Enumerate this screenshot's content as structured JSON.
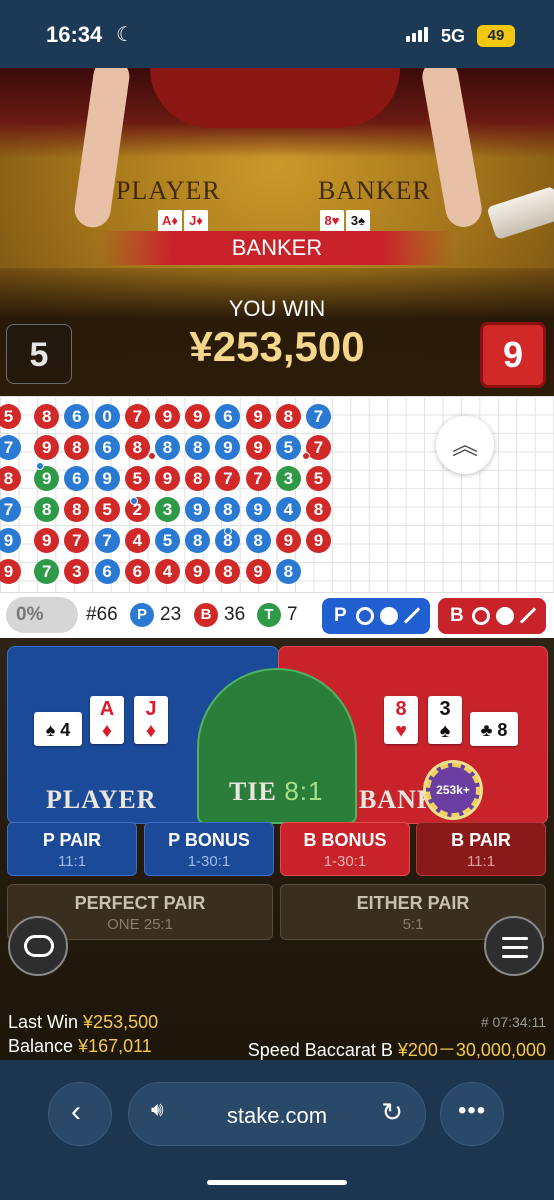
{
  "status_bar": {
    "time": "16:34",
    "network": "5G",
    "battery": "49"
  },
  "video": {
    "felt_player": "PLAYER",
    "felt_banker": "BANKER",
    "player_cards_mini": [
      {
        "rank": "A",
        "suit": "♦"
      },
      {
        "rank": "J",
        "suit": "♦"
      }
    ],
    "banker_cards_mini": [
      {
        "rank": "8",
        "suit": "♥"
      },
      {
        "rank": "3",
        "suit": "♠"
      }
    ],
    "result_banner": "BANKER",
    "win_title": "YOU WIN",
    "win_amount": "¥253,500",
    "player_score": "5",
    "banker_score": "9"
  },
  "roadmap": {
    "columns": [
      [
        {
          "v": "5",
          "c": "r"
        },
        {
          "v": "7",
          "c": "b"
        },
        {
          "v": "8",
          "c": "r"
        },
        {
          "v": "7",
          "c": "b"
        },
        {
          "v": "9",
          "c": "b"
        },
        {
          "v": "9",
          "c": "r"
        }
      ],
      [
        {
          "v": "8",
          "c": "r"
        },
        {
          "v": "9",
          "c": "r"
        },
        {
          "v": "9",
          "c": "g"
        },
        {
          "v": "8",
          "c": "g"
        },
        {
          "v": "9",
          "c": "r"
        },
        {
          "v": "7",
          "c": "g"
        }
      ],
      [
        {
          "v": "6",
          "c": "b"
        },
        {
          "v": "8",
          "c": "r"
        },
        {
          "v": "6",
          "c": "b"
        },
        {
          "v": "8",
          "c": "r"
        },
        {
          "v": "7",
          "c": "r"
        },
        {
          "v": "3",
          "c": "r"
        }
      ],
      [
        {
          "v": "0",
          "c": "b"
        },
        {
          "v": "6",
          "c": "b"
        },
        {
          "v": "9",
          "c": "b"
        },
        {
          "v": "5",
          "c": "r"
        },
        {
          "v": "7",
          "c": "b"
        },
        {
          "v": "6",
          "c": "b"
        }
      ],
      [
        {
          "v": "7",
          "c": "r"
        },
        {
          "v": "8",
          "c": "r"
        },
        {
          "v": "5",
          "c": "r"
        },
        {
          "v": "2",
          "c": "r"
        },
        {
          "v": "4",
          "c": "r"
        },
        {
          "v": "6",
          "c": "r"
        }
      ],
      [
        {
          "v": "9",
          "c": "r"
        },
        {
          "v": "8",
          "c": "b"
        },
        {
          "v": "9",
          "c": "r"
        },
        {
          "v": "3",
          "c": "g"
        },
        {
          "v": "5",
          "c": "b"
        },
        {
          "v": "4",
          "c": "r"
        }
      ],
      [
        {
          "v": "9",
          "c": "r"
        },
        {
          "v": "8",
          "c": "b"
        },
        {
          "v": "8",
          "c": "r"
        },
        {
          "v": "9",
          "c": "b"
        },
        {
          "v": "8",
          "c": "b"
        },
        {
          "v": "9",
          "c": "r"
        }
      ],
      [
        {
          "v": "6",
          "c": "b"
        },
        {
          "v": "9",
          "c": "b"
        },
        {
          "v": "7",
          "c": "r"
        },
        {
          "v": "8",
          "c": "b"
        },
        {
          "v": "8",
          "c": "b"
        },
        {
          "v": "8",
          "c": "r"
        }
      ],
      [
        {
          "v": "9",
          "c": "r"
        },
        {
          "v": "9",
          "c": "r"
        },
        {
          "v": "7",
          "c": "r"
        },
        {
          "v": "9",
          "c": "b"
        },
        {
          "v": "8",
          "c": "b"
        },
        {
          "v": "9",
          "c": "r"
        }
      ],
      [
        {
          "v": "8",
          "c": "r"
        },
        {
          "v": "5",
          "c": "b"
        },
        {
          "v": "3",
          "c": "g"
        },
        {
          "v": "4",
          "c": "b"
        },
        {
          "v": "9",
          "c": "r"
        },
        {
          "v": "8",
          "c": "b"
        }
      ],
      [
        {
          "v": "7",
          "c": "b"
        },
        {
          "v": "7",
          "c": "r"
        },
        {
          "v": "5",
          "c": "r"
        },
        {
          "v": "8",
          "c": "r"
        },
        {
          "v": "9",
          "c": "r"
        }
      ]
    ]
  },
  "stats": {
    "percent": "0%",
    "round_number": "#66",
    "player_label": "P",
    "player_count": "23",
    "banker_label": "B",
    "banker_count": "36",
    "tie_label": "T",
    "tie_count": "7",
    "player_ask": "P",
    "banker_ask": "B"
  },
  "bets": {
    "player": "PLAYER",
    "tie": "TIE",
    "tie_odds": "8:1",
    "banker": "BANKER",
    "chip": "253k+",
    "player_cards": [
      {
        "rank": "4",
        "suit": "♠",
        "side": true
      },
      {
        "rank": "A",
        "suit": "♦"
      },
      {
        "rank": "J",
        "suit": "♦"
      }
    ],
    "banker_cards": [
      {
        "rank": "8",
        "suit": "♥"
      },
      {
        "rank": "3",
        "suit": "♠"
      },
      {
        "rank": "8",
        "suit": "♣",
        "side": true
      }
    ],
    "p_pair": "P PAIR",
    "p_pair_odds": "11:1",
    "p_bonus": "P BONUS",
    "p_bonus_odds": "1-30:1",
    "b_bonus": "B BONUS",
    "b_bonus_odds": "1-30:1",
    "b_pair": "B PAIR",
    "b_pair_odds": "11:1",
    "perfect_pair": "PERFECT PAIR",
    "perfect_pair_odds": "ONE 25:1",
    "either_pair": "EITHER PAIR",
    "either_pair_odds": "5:1"
  },
  "info": {
    "last_win_label": "Last Win",
    "last_win_value": "¥253,500",
    "balance_label": "Balance",
    "balance_value": "¥167,011",
    "round_id": "# 07:34:11",
    "table_name": "Speed Baccarat B",
    "limits": "¥200－30,000,000"
  },
  "browser": {
    "url": "stake.com"
  },
  "colors": {
    "player_blue": "#1b4a99",
    "banker_red": "#c8232b",
    "tie_green": "#2a7e3a",
    "gold": "#f2c94c"
  }
}
